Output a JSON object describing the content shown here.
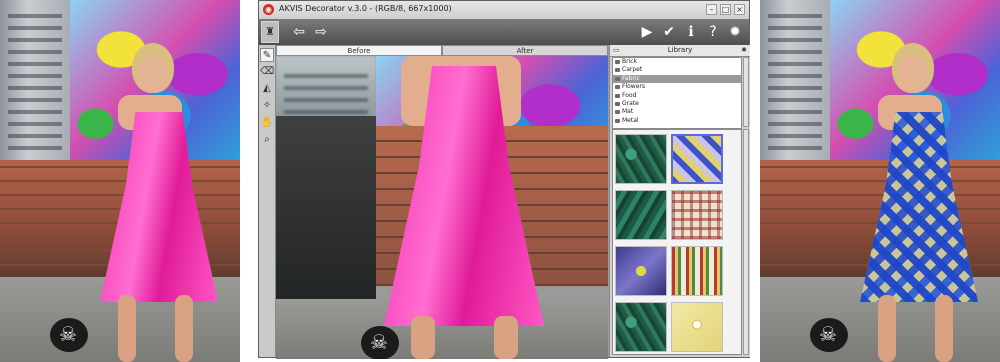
{
  "window": {
    "title": "AKVIS Decorator v.3.0 - (RGB/8, 667x1000)"
  },
  "toolbar": {
    "left_icons": [
      "app-logo-icon",
      "undo-arrow-icon",
      "redo-arrow-icon"
    ],
    "right_icons": [
      "run-triangle-icon",
      "apply-check-icon",
      "info-icon",
      "help-icon",
      "settings-gear-icon"
    ]
  },
  "tools": [
    "brush-icon",
    "eraser-icon",
    "fill-bucket-icon",
    "magic-wand-icon",
    "hand-icon",
    "zoom-icon"
  ],
  "tabs": {
    "before": "Before",
    "after": "After"
  },
  "library": {
    "header": "Library",
    "items": [
      "Brick",
      "Carpet",
      "Fabric",
      "Flowers",
      "Food",
      "Grate",
      "Mat",
      "Metal"
    ],
    "selected": "Fabric"
  },
  "colors": {
    "dress_pink": "#f62fb0",
    "toolbar_dark": "#4e4e4e",
    "selection_blue": "#5a6bd8"
  }
}
